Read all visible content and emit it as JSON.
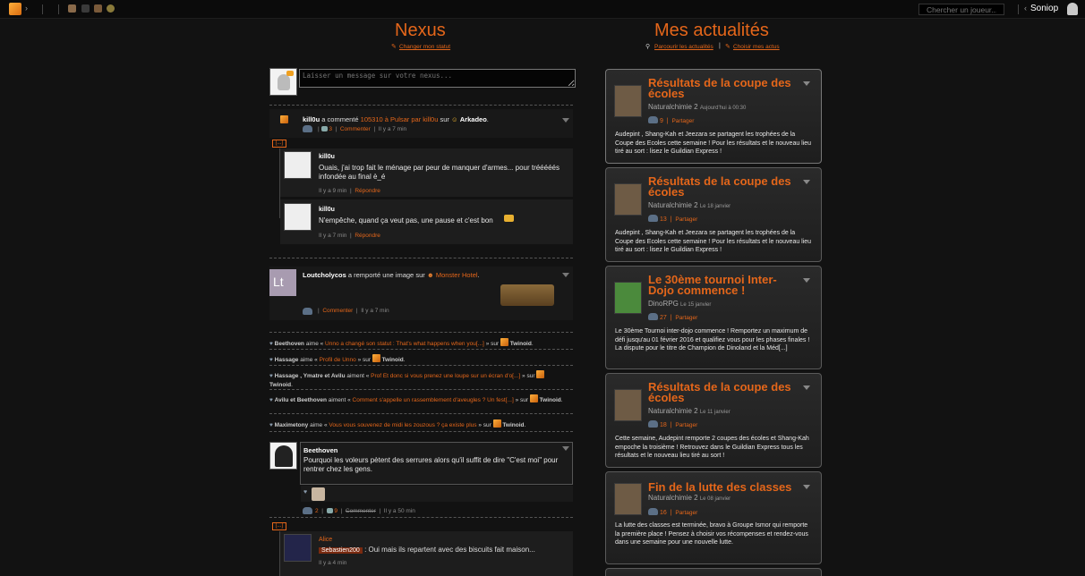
{
  "topbar": {
    "search_placeholder": "Chercher un joueur...",
    "username": "Soniop"
  },
  "nexus": {
    "title": "Nexus",
    "change_status": "Changer mon statut",
    "message_placeholder": "Laisser un message sur votre nexus..."
  },
  "news_header": {
    "title": "Mes actualités",
    "browse": "Parcourir les actualités",
    "separator": "|",
    "choose": "Choisir mes actus"
  },
  "feed": {
    "comment_entry": {
      "author": "kill0u",
      "action": "a commenté",
      "target": "105310 à Pulsar par kill0u",
      "on": "sur",
      "game": "Arkadeo",
      "period": ".",
      "comment_count": "3",
      "comment_label": "Commenter",
      "time": "Il y a 7 min",
      "expand": "[...]",
      "replies": [
        {
          "author": "kill0u",
          "text": "Ouais, j'ai trop fait le ménage par peur de manquer d'armes... pour trééééés infondée au final è_é",
          "time": "Il y a 9 min",
          "reply_label": "Répondre"
        },
        {
          "author": "kill0u",
          "text": "N'empêche, quand ça veut pas, une pause et c'est bon",
          "time": "Il y a 7 min",
          "reply_label": "Répondre"
        }
      ]
    },
    "image_entry": {
      "author": "Loutcholycos",
      "action": "a remporté une image sur",
      "game": "Monster Hotel",
      "period": ".",
      "comment_label": "Commenter",
      "time": "Il y a 7 min"
    },
    "likes": [
      {
        "who": "Beethoven",
        "verb": "aime «",
        "what": "Unno a changé son statut : That's what happens when you[...]",
        "end": "» sur",
        "site": "Twinoid",
        "period": "."
      },
      {
        "who": "Hassage",
        "verb": "aime «",
        "what": "Profil de Unno",
        "end": "» sur",
        "site": "Twinoid",
        "period": "."
      },
      {
        "who": "Hassage , Ymatre et Avilu",
        "verb": "aiment «",
        "what": "Prof Et donc si vous prenez une loupe sur un écran d'o[...]",
        "end": "» sur",
        "site": "Twinoid",
        "period": "."
      },
      {
        "who": "Avilu et Beethoven",
        "verb": "aiment «",
        "what": "Comment s'appelle un rassemblement d'aveugles ? Un fest[...]",
        "end": "» sur",
        "site": "Twinoid",
        "period": "."
      },
      {
        "who": "Maximetony",
        "verb": "aime «",
        "what": "Vous vous souvenez de midi les zouzous ? ça existe plus",
        "end": "» sur",
        "site": "Twinoid",
        "period": "."
      }
    ],
    "status_entry": {
      "author": "Beethoven",
      "text": "Pourquoi les voleurs pètent des serrures alors qu'il suffit de dire \"C'est moi\" pour rentrer chez les gens.",
      "likes": "2",
      "comments": "9",
      "comment_label": "Commenter",
      "time": "Il y a 50 min",
      "expand": "[...]",
      "reply": {
        "author": "Alice",
        "mention": "Sebastien200",
        "text": ": Oui mais ils repartent avec des biscuits fait maison...",
        "time": "Il y a 4 min"
      }
    }
  },
  "news": [
    {
      "title": "Résultats de la coupe des écoles",
      "source": "Naturalchimie 2",
      "date": "Aujourd'hui à 00:30",
      "count": "9",
      "share": "Partager",
      "body": "Audepint , Shang-Kah et Jeezara se partagent les trophées de la Coupe des Ecoles cette semaine ! Pour les résultats et le nouveau lieu tiré au sort : lisez le Guildian Express !",
      "color": "#6e5b45"
    },
    {
      "title": "Résultats de la coupe des écoles",
      "source": "Naturalchimie 2",
      "date": "Le 18 janvier",
      "count": "13",
      "share": "Partager",
      "body": "Audepint , Shang-Kah et Jeezara se partagent les trophées de la Coupe des Ecoles cette semaine ! Pour les résultats et le nouveau lieu tiré au sort : lisez le Guildian Express !",
      "color": "#6e5b45"
    },
    {
      "title": "Le 30ème tournoi Inter-Dojo commence !",
      "source": "DinoRPG",
      "date": "Le 15 janvier",
      "count": "27",
      "share": "Partager",
      "body": "Le 30ème Tournoi inter-dojo commence ! Remportez un maximum de défi jusqu'au 01 février 2016 et qualifiez vous pour les phases finales ! La dispute pour le titre de Champion de Dinoland et la Méd[...]",
      "color": "#4b8a3c"
    },
    {
      "title": "Résultats de la coupe des écoles",
      "source": "Naturalchimie 2",
      "date": "Le 11 janvier",
      "count": "18",
      "share": "Partager",
      "body": "Cette semaine, Audepint remporte 2 coupes des écoles et Shang-Kah empoche la troisième ! Retrouvez dans le Guildian Express tous les résultats et le nouveau lieu tiré au sort !",
      "color": "#6e5b45"
    },
    {
      "title": "Fin de la lutte des classes",
      "source": "Naturalchimie 2",
      "date": "Le 08 janvier",
      "count": "16",
      "share": "Partager",
      "body": "La lutte des classes est terminée, bravo à Groupe Ismor qui remporte la première place ! Pensez à choisir vos récompenses et rendez-vous dans une semaine pour une nouvelle lutte.",
      "color": "#6e5b45"
    }
  ]
}
